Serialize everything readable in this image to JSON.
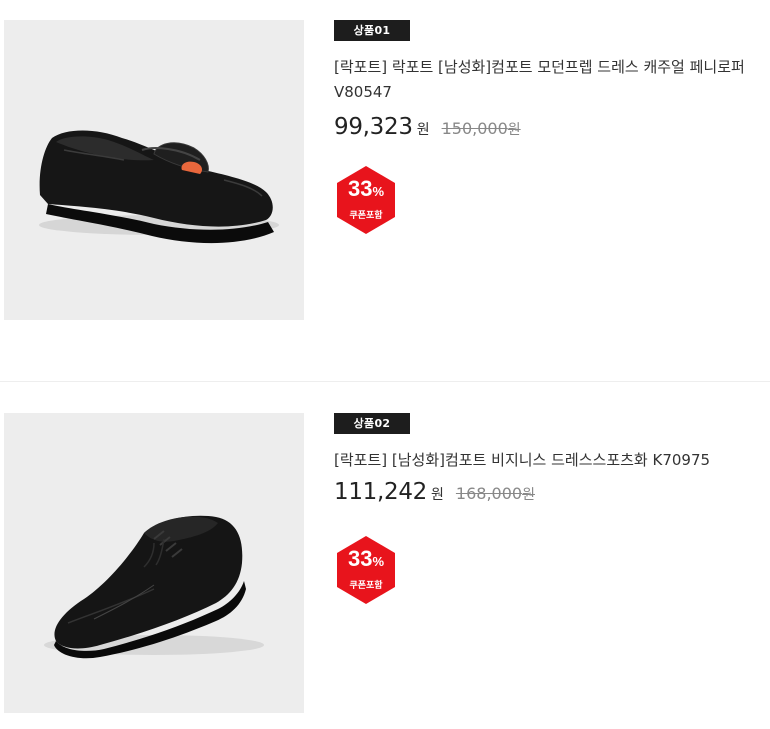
{
  "products": [
    {
      "rank_label": "상품01",
      "title": "[락포트] 락포트 [남성화]컴포트 모던프렙 드레스 캐주얼 페니로퍼 V80547",
      "price": "99,323",
      "price_unit": "원",
      "original_price": "150,000",
      "original_unit": "원",
      "discount_number": "33",
      "discount_suffix": "%",
      "discount_note": "쿠폰포함",
      "image_icon": "penny-loafer-shoe-image"
    },
    {
      "rank_label": "상품02",
      "title": "[락포트] [남성화]컴포트 비지니스 드레스스포츠화 K70975",
      "price": "111,242",
      "price_unit": "원",
      "original_price": "168,000",
      "original_unit": "원",
      "discount_number": "33",
      "discount_suffix": "%",
      "discount_note": "쿠폰포함",
      "image_icon": "derby-shoe-image"
    }
  ],
  "colors": {
    "badge_bg": "#1d1d1d",
    "discount_red": "#e8141c",
    "thumb_bg": "#ededed"
  }
}
